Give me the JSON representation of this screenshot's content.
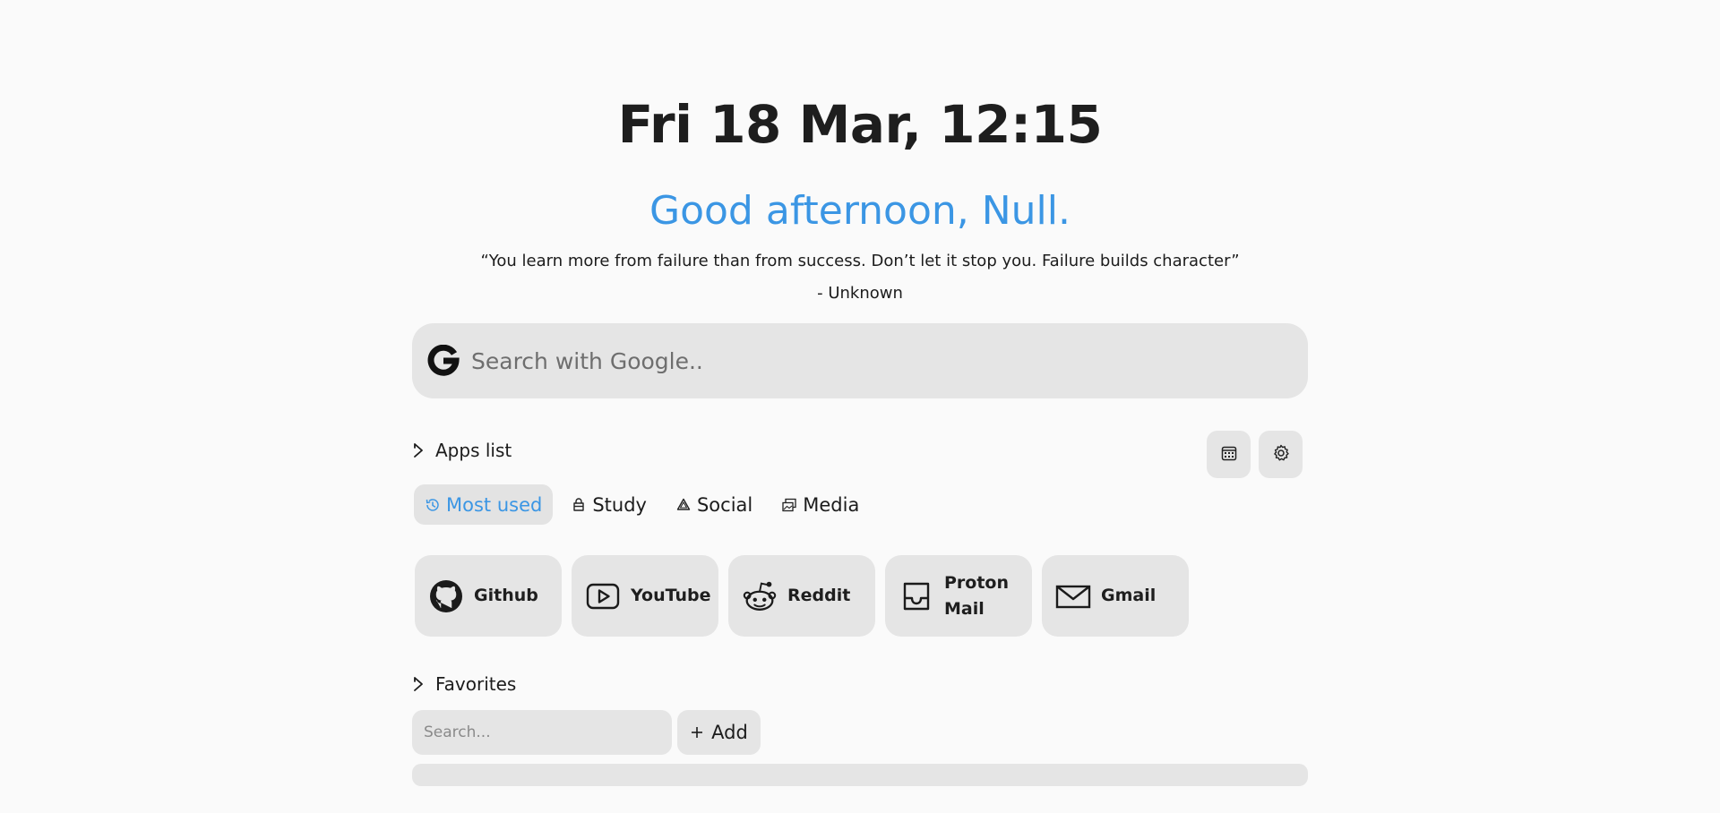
{
  "clock": {
    "text": "Fri 18 Mar, 12:15"
  },
  "greeting": {
    "text": "Good afternoon, Null."
  },
  "quote": {
    "text": "“You learn more from failure than from success. Don’t let it stop you. Failure builds character”",
    "author": "- Unknown"
  },
  "search": {
    "placeholder": "Search with Google..",
    "engine_icon": "google-icon",
    "value": ""
  },
  "apps_section": {
    "title": "Apps list",
    "tabs": [
      {
        "label": "Most used",
        "icon": "history-icon",
        "active": true
      },
      {
        "label": "Study",
        "icon": "backpack-icon",
        "active": false
      },
      {
        "label": "Social",
        "icon": "recycle-icon",
        "active": false
      },
      {
        "label": "Media",
        "icon": "images-icon",
        "active": false
      }
    ],
    "apps": [
      {
        "label": "Github",
        "icon": "github-icon"
      },
      {
        "label": "YouTube",
        "icon": "youtube-icon"
      },
      {
        "label": "Reddit",
        "icon": "reddit-icon"
      },
      {
        "label": "Proton Mail",
        "icon": "inbox-icon"
      },
      {
        "label": "Gmail",
        "icon": "mail-icon"
      }
    ],
    "calendar_button": "calendar-icon",
    "settings_button": "gear-icon"
  },
  "favorites_section": {
    "title": "Favorites",
    "search_placeholder": "Search...",
    "search_value": "",
    "add_label": "Add"
  },
  "colors": {
    "accent": "#3b96e4",
    "background": "#fafafa",
    "surface": "#e5e5e5",
    "text": "#1c1c1c"
  }
}
